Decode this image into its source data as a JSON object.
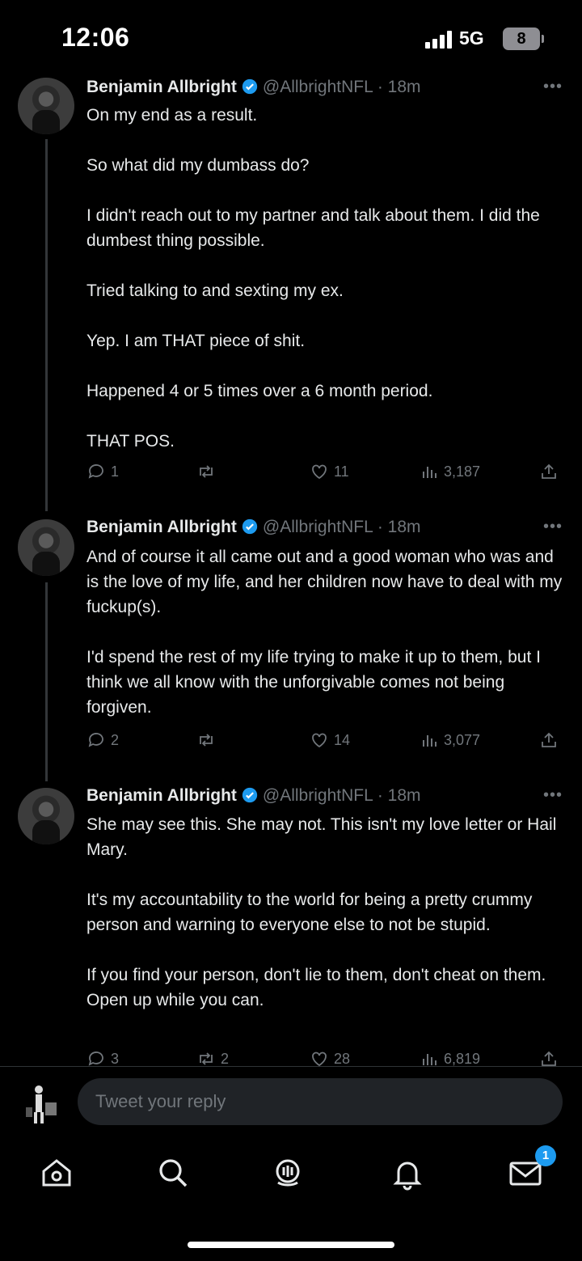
{
  "status_bar": {
    "time": "12:06",
    "network": "5G",
    "battery": "8"
  },
  "tweets": [
    {
      "name": "Benjamin Allbright",
      "handle": "@AllbrightNFL",
      "time": "18m",
      "paragraphs": [
        "On my end as a result.",
        "So what did my dumbass do?",
        "I didn't reach out to my partner and talk about them. I did the dumbest thing possible.",
        "Tried talking to and sexting my ex.",
        "Yep. I am THAT piece of shit.",
        "Happened 4 or 5 times over a 6 month period.",
        "THAT POS."
      ],
      "replies": "1",
      "retweets": "",
      "likes": "11",
      "views": "3,187"
    },
    {
      "name": "Benjamin Allbright",
      "handle": "@AllbrightNFL",
      "time": "18m",
      "paragraphs": [
        "And of course it all came out and a good woman who was and is the love of my life, and her children now have to deal with my fuckup(s).",
        "I'd spend the rest of my life trying to make it up to them, but I think we all know with the unforgivable comes not being forgiven."
      ],
      "replies": "2",
      "retweets": "",
      "likes": "14",
      "views": "3,077"
    },
    {
      "name": "Benjamin Allbright",
      "handle": "@AllbrightNFL",
      "time": "18m",
      "paragraphs": [
        "She may see this. She may not. This isn't my love letter or Hail Mary.",
        "It's my accountability to the world for being a pretty crummy person and warning to everyone else to not be stupid.",
        "If you find your person, don't lie to them, don't cheat on them. Open up while you can."
      ],
      "replies": "3",
      "retweets": "2",
      "likes": "28",
      "views": "6,819"
    }
  ],
  "reply": {
    "placeholder": "Tweet your reply"
  },
  "nav": {
    "items": [
      "home-icon",
      "search-icon",
      "spaces-icon",
      "notifications-icon",
      "messages-icon"
    ],
    "messages_badge": "1"
  },
  "colors": {
    "accent": "#1d9bf0",
    "muted": "#71767b",
    "text": "#e7e9ea",
    "background": "#000000"
  }
}
